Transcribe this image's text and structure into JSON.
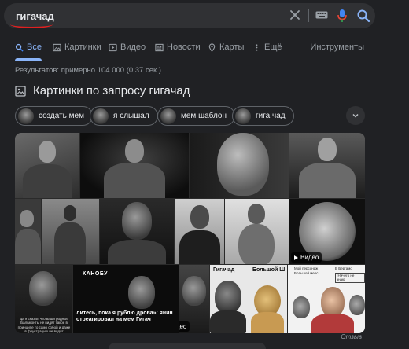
{
  "search": {
    "query": "гигачад"
  },
  "tabs": [
    {
      "label": "Все"
    },
    {
      "label": "Картинки"
    },
    {
      "label": "Видео"
    },
    {
      "label": "Новости"
    },
    {
      "label": "Карты"
    },
    {
      "label": "Ещё"
    }
  ],
  "tools_label": "Инструменты",
  "stats": "Результатов: примерно 104 000 (0,37 сек.)",
  "images_section": {
    "title": "Картинки по запросу гигачад",
    "chips": [
      "создать мем",
      "я слышал",
      "мем шаблон",
      "гига чад"
    ]
  },
  "tiles": {
    "video_label": "Видео",
    "kanobu_brand": "КАНОБУ",
    "kanobu_caption": "литесь, пока я рублю дрова»: янин отреагировал на мем Гигач",
    "meme_label_1": "Гигачад",
    "meme_label_2": "Большой Ш",
    "small_left_caption": "Да я сказал что ваши родные Бальмонты не видят такое в принципе то само собой и даже в фрустрацию не видят",
    "meme_note_1": "Мой персонаж",
    "meme_note_2": "Большой мерс",
    "meme_note_3": "В Бергамо",
    "meme_note_4": "(Ничего не знаю"
  },
  "feedback_label": "Отзыв"
}
